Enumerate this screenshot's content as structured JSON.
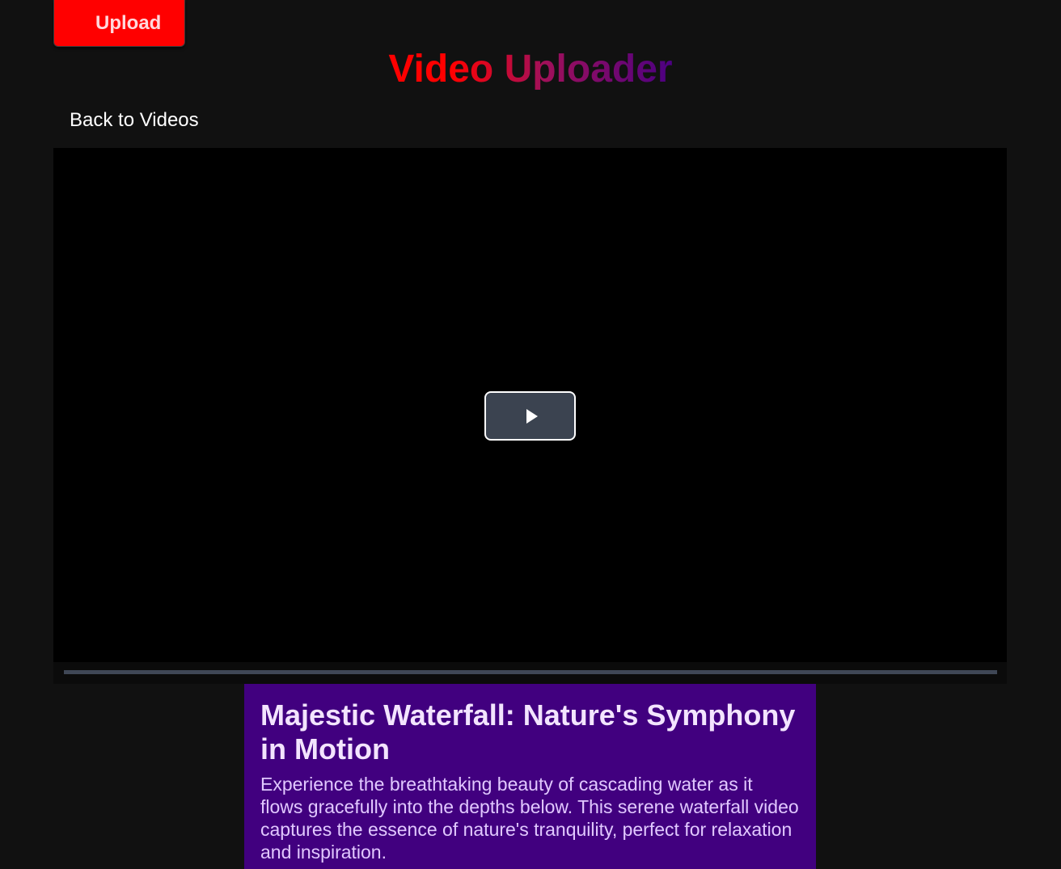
{
  "header": {
    "upload_label": "Upload",
    "title": "Video Uploader",
    "back_link_label": "Back to Videos"
  },
  "player": {
    "play_icon": "play-icon",
    "progress_fraction": 0
  },
  "video": {
    "title": "Majestic Waterfall: Nature's Symphony in Motion",
    "description": "Experience the breathtaking beauty of cascading water as it flows gracefully into the depths below. This serene waterfall video captures the essence of nature's tranquility, perfect for relaxation and inspiration."
  },
  "colors": {
    "background": "#111111",
    "upload_button": "#ff0000",
    "title_gradient_start": "#ff0000",
    "title_gradient_end": "#4b0082",
    "info_card": "#41007f",
    "progress_track": "#3f4756",
    "play_button": "#3b4350"
  }
}
